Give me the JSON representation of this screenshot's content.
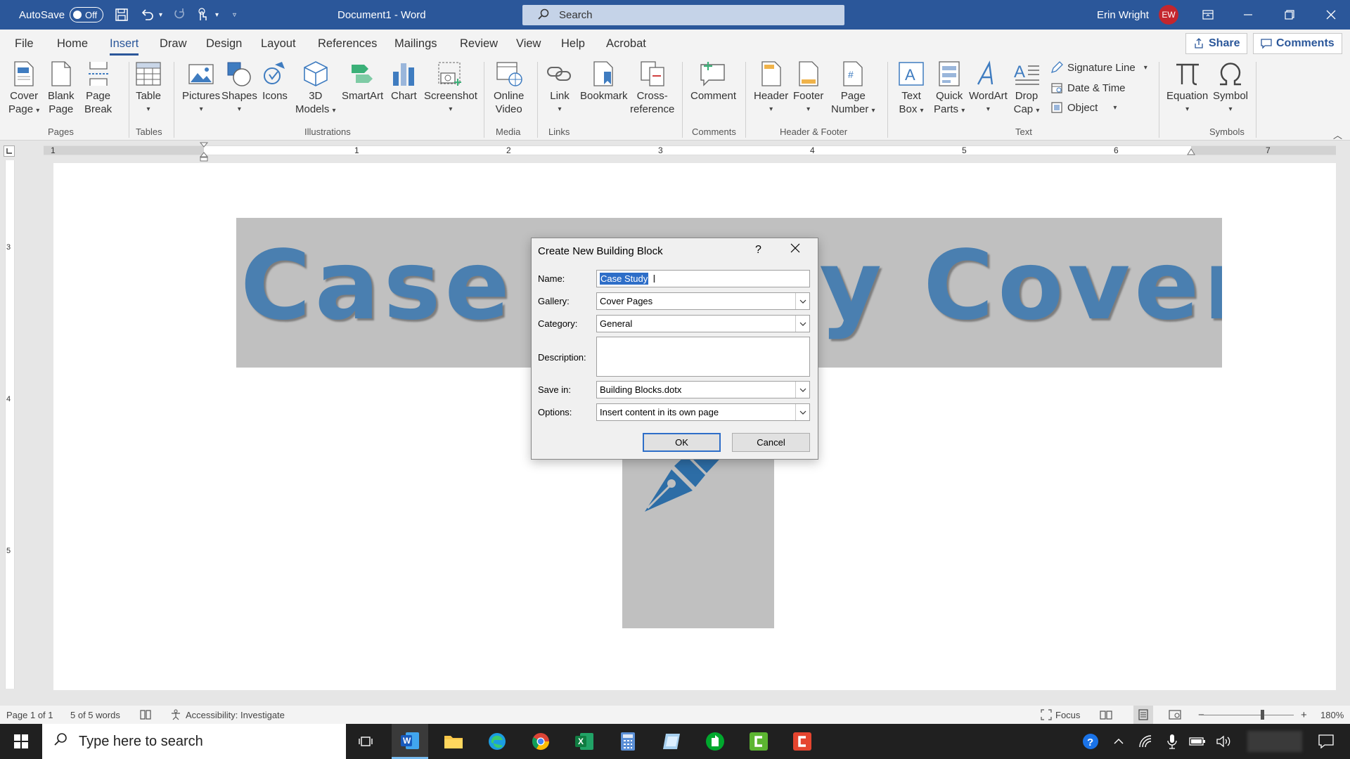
{
  "titlebar": {
    "autosave_label": "AutoSave",
    "autosave_state": "Off",
    "doc_title": "Document1  -  Word",
    "search_placeholder": "Search",
    "user_name": "Erin Wright",
    "user_initials": "EW"
  },
  "tabs": [
    "File",
    "Home",
    "Insert",
    "Draw",
    "Design",
    "Layout",
    "References",
    "Mailings",
    "Review",
    "View",
    "Help",
    "Acrobat"
  ],
  "active_tab": "Insert",
  "share_label": "Share",
  "comments_label": "Comments",
  "ribbon": {
    "pages": {
      "group": "Pages",
      "cover_page": [
        "Cover",
        "Page"
      ],
      "blank_page": [
        "Blank",
        "Page"
      ],
      "page_break": [
        "Page",
        "Break"
      ]
    },
    "tables": {
      "group": "Tables",
      "table": "Table"
    },
    "illustrations": {
      "group": "Illustrations",
      "pictures": "Pictures",
      "shapes": "Shapes",
      "icons": "Icons",
      "models": [
        "3D",
        "Models"
      ],
      "smartart": "SmartArt",
      "chart": "Chart",
      "screenshot": "Screenshot"
    },
    "media": {
      "group": "Media",
      "online_video": [
        "Online",
        "Video"
      ]
    },
    "links": {
      "group": "Links",
      "link": "Link",
      "bookmark": "Bookmark",
      "cross_ref": [
        "Cross-",
        "reference"
      ]
    },
    "comments": {
      "group": "Comments",
      "comment": "Comment"
    },
    "header_footer": {
      "group": "Header & Footer",
      "header": "Header",
      "footer": "Footer",
      "page_number": [
        "Page",
        "Number"
      ]
    },
    "text": {
      "group": "Text",
      "text_box": [
        "Text",
        "Box"
      ],
      "quick_parts": [
        "Quick",
        "Parts"
      ],
      "wordart": "WordArt",
      "drop_cap": [
        "Drop",
        "Cap"
      ],
      "signature_line": "Signature Line",
      "date_time": "Date & Time",
      "object": "Object"
    },
    "symbols": {
      "group": "Symbols",
      "equation": "Equation",
      "symbol": "Symbol"
    }
  },
  "ruler": {
    "h_numbers": [
      "1",
      "1",
      "2",
      "3",
      "4",
      "5",
      "6",
      "7"
    ],
    "v_numbers": [
      "3",
      "4",
      "5"
    ]
  },
  "document": {
    "banner_text": "Case Study Cover"
  },
  "dialog": {
    "title": "Create New Building Block",
    "help": "?",
    "name_label": "Name:",
    "name_value": "Case Study",
    "gallery_label": "Gallery:",
    "gallery_value": "Cover Pages",
    "category_label": "Category:",
    "category_value": "General",
    "description_label": "Description:",
    "save_in_label": "Save in:",
    "save_in_value": "Building Blocks.dotx",
    "options_label": "Options:",
    "options_value": "Insert content in its own page",
    "ok_label": "OK",
    "cancel_label": "Cancel"
  },
  "statusbar": {
    "page": "Page 1 of 1",
    "words": "5 of 5 words",
    "accessibility": "Accessibility: Investigate",
    "focus": "Focus",
    "zoom": "180%"
  },
  "taskbar": {
    "search_placeholder": "Type here to search"
  },
  "colors": {
    "word_blue": "#2b579a",
    "banner_text": "#4a7fb0",
    "pen": "#2d6da6",
    "highlight": "#2e6ec8",
    "taskbar": "#202020"
  }
}
